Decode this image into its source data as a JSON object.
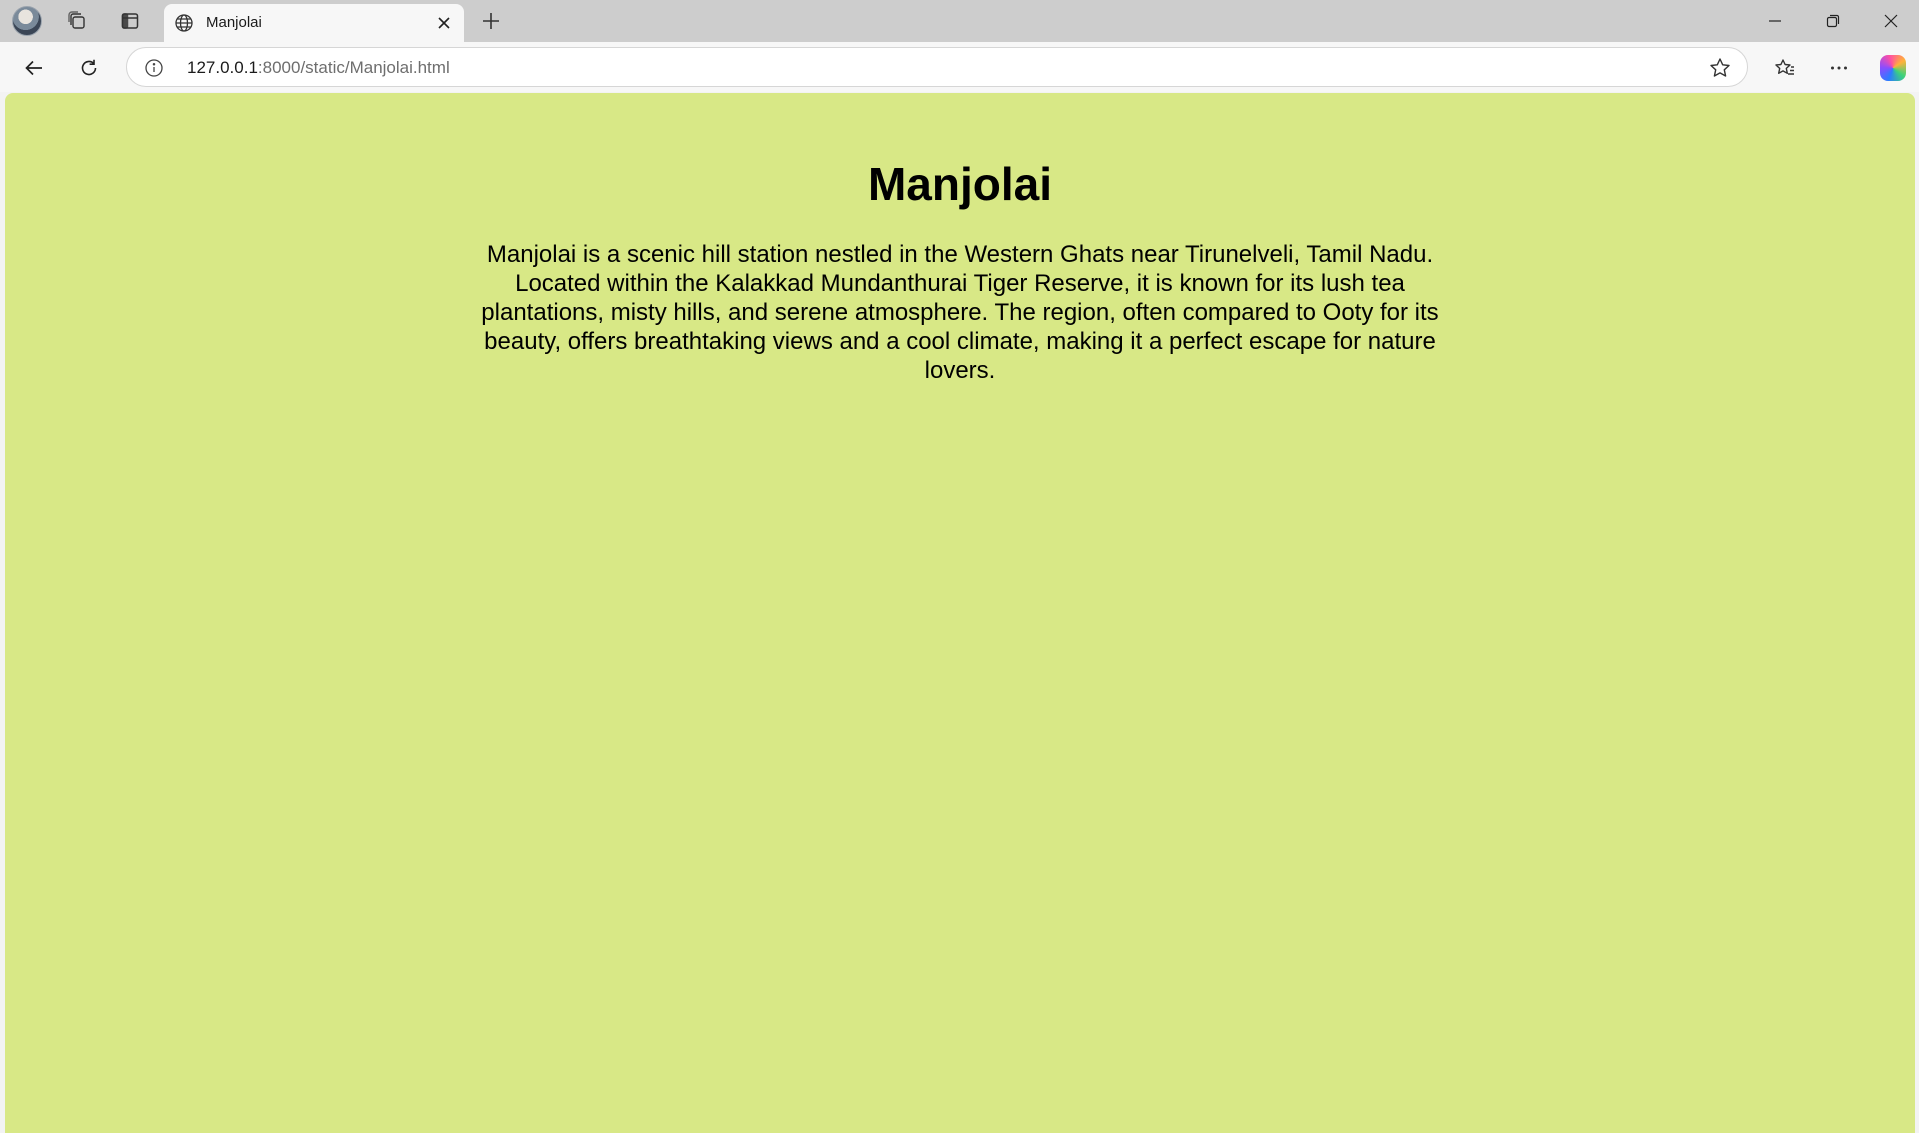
{
  "browser": {
    "tab": {
      "title": "Manjolai"
    },
    "address_bar": {
      "host": "127.0.0.1",
      "path": ":8000/static/Manjolai.html"
    }
  },
  "page": {
    "heading": "Manjolai",
    "description": "Manjolai is a scenic hill station nestled in the Western Ghats near Tirunelveli, Tamil Nadu. Located within the Kalakkad Mundanthurai Tiger Reserve, it is known for its lush tea plantations, misty hills, and serene atmosphere. The region, often compared to Ooty for its beauty, offers breathtaking views and a cool climate, making it a perfect escape for nature lovers.",
    "background_color": "#d8e886"
  },
  "icons": {
    "profile": "profile-avatar",
    "workspaces": "workspaces-icon",
    "vertical_tabs": "vertical-tabs-icon",
    "tab_favicon": "globe-icon",
    "tab_close": "close-icon",
    "new_tab": "plus-icon",
    "minimize": "minimize-icon",
    "restore": "restore-icon",
    "close_window": "close-icon",
    "back": "back-arrow-icon",
    "refresh": "refresh-icon",
    "site_info": "info-icon",
    "favorite": "star-icon",
    "favorites": "favorites-icon",
    "more": "more-icon",
    "copilot": "copilot-icon"
  }
}
